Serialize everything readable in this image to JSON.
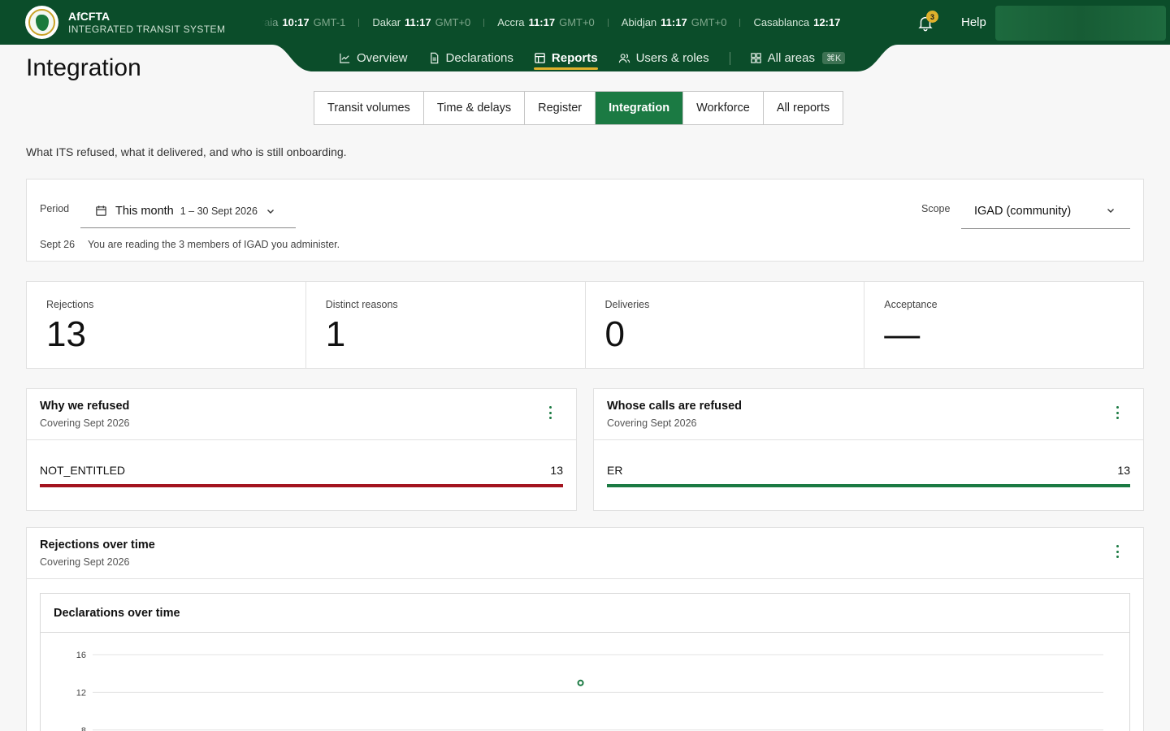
{
  "header": {
    "brand_name": "AfCFTA",
    "brand_sub": "INTEGRATED TRANSIT SYSTEM",
    "clocks": [
      {
        "city": "Praia",
        "time": "10:17",
        "tz": "GMT-1"
      },
      {
        "city": "Dakar",
        "time": "11:17",
        "tz": "GMT+0"
      },
      {
        "city": "Accra",
        "time": "11:17",
        "tz": "GMT+0"
      },
      {
        "city": "Abidjan",
        "time": "11:17",
        "tz": "GMT+0"
      },
      {
        "city": "Casablanca",
        "time": "12:17",
        "tz": ""
      }
    ],
    "notifications_count": "3",
    "help_label": "Help"
  },
  "nav": {
    "overview": "Overview",
    "declarations": "Declarations",
    "reports": "Reports",
    "users_roles": "Users & roles",
    "all_areas": "All areas",
    "shortcut": "⌘K"
  },
  "page": {
    "title": "Integration",
    "subtitle": "What ITS refused, what it delivered, and who is still onboarding."
  },
  "subtabs": [
    "Transit volumes",
    "Time & delays",
    "Register",
    "Integration",
    "Workforce",
    "All reports"
  ],
  "filters": {
    "period_label": "Period",
    "period_value": "This month",
    "period_range": "1 – 30 Sept 2026",
    "scope_label": "Scope",
    "scope_value": "IGAD (community)",
    "note_date": "Sept 26",
    "note_text": "You are reading the 3 members of IGAD you administer."
  },
  "kpis": [
    {
      "label": "Rejections",
      "value": "13"
    },
    {
      "label": "Distinct reasons",
      "value": "1"
    },
    {
      "label": "Deliveries",
      "value": "0"
    },
    {
      "label": "Acceptance",
      "value": "—"
    }
  ],
  "panels": {
    "why_refused": {
      "title": "Why we refused",
      "sub": "Covering Sept 2026",
      "row_label": "NOT_ENTITLED",
      "row_value": "13",
      "fraction": 1.0,
      "color": "#a3141f"
    },
    "whose_calls": {
      "title": "Whose calls are refused",
      "sub": "Covering Sept 2026",
      "row_label": "ER",
      "row_value": "13",
      "fraction": 1.0,
      "color": "#1b7a43"
    },
    "over_time": {
      "title": "Rejections over time",
      "sub": "Covering Sept 2026",
      "inner_title": "Declarations over time"
    }
  },
  "colors": {
    "brand_green": "#0b4d2a",
    "accent_green": "#1b7a43",
    "accent_gold": "#e0b12c",
    "danger_red": "#a3141f"
  },
  "chart_data": {
    "type": "scatter",
    "title": "Declarations over time",
    "xlabel": "",
    "ylabel": "",
    "y_ticks": [
      "16",
      "12",
      "8"
    ],
    "ylim": [
      8,
      16
    ],
    "x_range": [
      "2026-09-01",
      "2026-09-30"
    ],
    "points": [
      {
        "x": "2026-09-15",
        "y": 13
      }
    ],
    "grid": true,
    "point_color": "#1b7a43"
  }
}
